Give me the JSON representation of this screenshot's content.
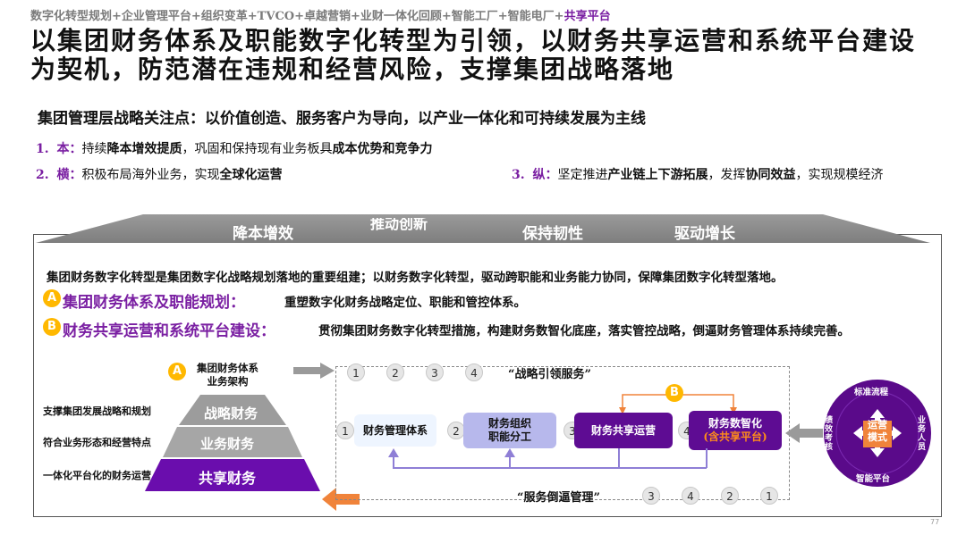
{
  "breadcrumb": {
    "items": "数字化转型规划+企业管理平台+组织变革+TVCO+卓越营销+业财一体化回顾+智能工厂+智能电厂+",
    "current": "共享平台"
  },
  "headline": "以集团财务体系及职能数字化转型为引领，以财务共享运营和系统平台建设为契机，防范潜在违规和经营风险，支撑集团战略落地",
  "subheading": "集团管理层战略关注点：以价值创造、服务客户为导向，以产业一体化和可持续发展为主线",
  "points": [
    {
      "num": "1.",
      "key": "本：",
      "p1": "持续",
      "b1": "降本增效提质",
      "p2": "，巩固和保持现有业务板具",
      "b2": "成本优势和竞争力",
      "p3": "",
      "b3": "",
      "p4": ""
    },
    {
      "num": "2.",
      "key": "横：",
      "p1": "积极布局海外业务，实现",
      "b1": "全球化运营",
      "p2": "",
      "b2": "",
      "p3": "",
      "b3": "",
      "p4": ""
    },
    {
      "num": "3.",
      "key": "纵：",
      "p1": "坚定推进",
      "b1": "产业链上下游拓展",
      "p2": "，发挥",
      "b2": "协同效益",
      "p3": "，实现规模经济",
      "b3": "",
      "p4": ""
    }
  ],
  "banner_tabs": [
    "降本增效",
    "推动创新",
    "保持韧性",
    "驱动增长"
  ],
  "intro": "集团财务数字化转型是集团数字化战略规划落地的重要组建；以财务数字化转型，驱动跨职能和业务能力协同，保障集团数字化转型落地。",
  "sections": [
    {
      "badge": "A",
      "title": "集团财务体系及职能规划：",
      "desc": "重塑数字化财务战略定位、职能和管控体系。"
    },
    {
      "badge": "B",
      "title": "财务共享运营和系统平台建设：",
      "desc": "贯彻集团财务数字化转型措施，构建财务数智化底座，落实管控战略，倒逼财务管理体系持续完善。"
    }
  ],
  "pyramid": {
    "badge": "A",
    "caption": "集团财务体系\n业务架构",
    "levels": [
      "战略财务",
      "业务财务",
      "共享财务"
    ],
    "labels": [
      "支撑集团发展战略和规划",
      "符合业务形态和经营特点",
      "一体化平台化的财务运营"
    ]
  },
  "flow": {
    "top_title": "“战略引领服务”",
    "top_nums": [
      "1",
      "2",
      "3",
      "4"
    ],
    "bottom_title": "“服务倒逼管理”",
    "bottom_nums": [
      "3",
      "4",
      "2",
      "1"
    ],
    "b_badge": "B",
    "nodes": [
      {
        "num": "1",
        "label": "财务管理体系"
      },
      {
        "num": "2",
        "label": "财务组织\n职能分工"
      },
      {
        "num": "3",
        "label": "财务共享运营"
      },
      {
        "num": "4",
        "label": "财务数智化",
        "sub": "(含共享平台)"
      }
    ]
  },
  "ops_circle": {
    "center": "运营\n模式",
    "top": "标准流程",
    "right": "业务人员",
    "bottom": "智能平台",
    "left": "绩效考核"
  },
  "page_number": "77",
  "colors": {
    "accent": "#6a0dad",
    "badge": "#ffb800",
    "banner": "#8a8a8a",
    "arrow_orange": "#f0833a"
  }
}
